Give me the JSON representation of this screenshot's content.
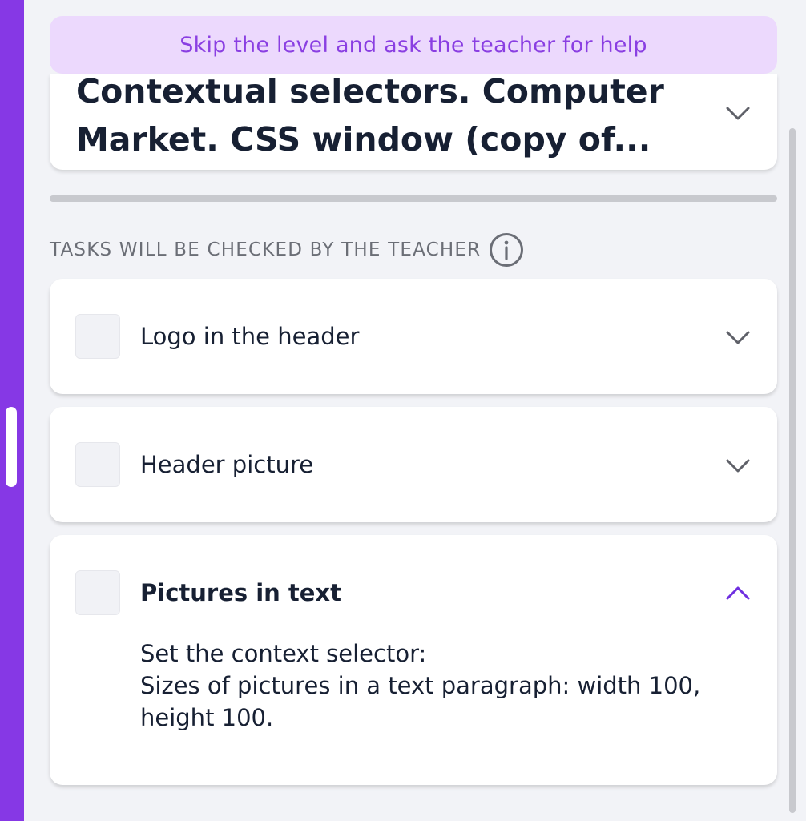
{
  "help_banner": {
    "label": "Skip the level and ask the teacher for help"
  },
  "level": {
    "title": "Contextual selectors. Computer Market. CSS window (copy of..."
  },
  "tasks_section": {
    "heading": "TASKS WILL BE CHECKED BY THE TEACHER",
    "tasks": [
      {
        "title": "Logo in the header",
        "expanded": false,
        "checked": false
      },
      {
        "title": "Header picture",
        "expanded": false,
        "checked": false
      },
      {
        "title": "Pictures in text",
        "expanded": true,
        "checked": false,
        "description": [
          "Set the context selector:",
          "Sizes of pictures in a text paragraph: width 100, height 100."
        ]
      }
    ]
  },
  "icons": {
    "collapsed_chevron": "chevron-down-icon",
    "expanded_chevron": "chevron-up-icon",
    "info": "info-icon"
  },
  "colors": {
    "accent": "#8638e5",
    "banner_bg": "#ecd9fd",
    "banner_text": "#8a3fe2",
    "page_bg": "#f2f3f7",
    "muted_text": "#6b6e76",
    "chevron_gray": "#5f6169",
    "chevron_active": "#6f2fe0"
  }
}
